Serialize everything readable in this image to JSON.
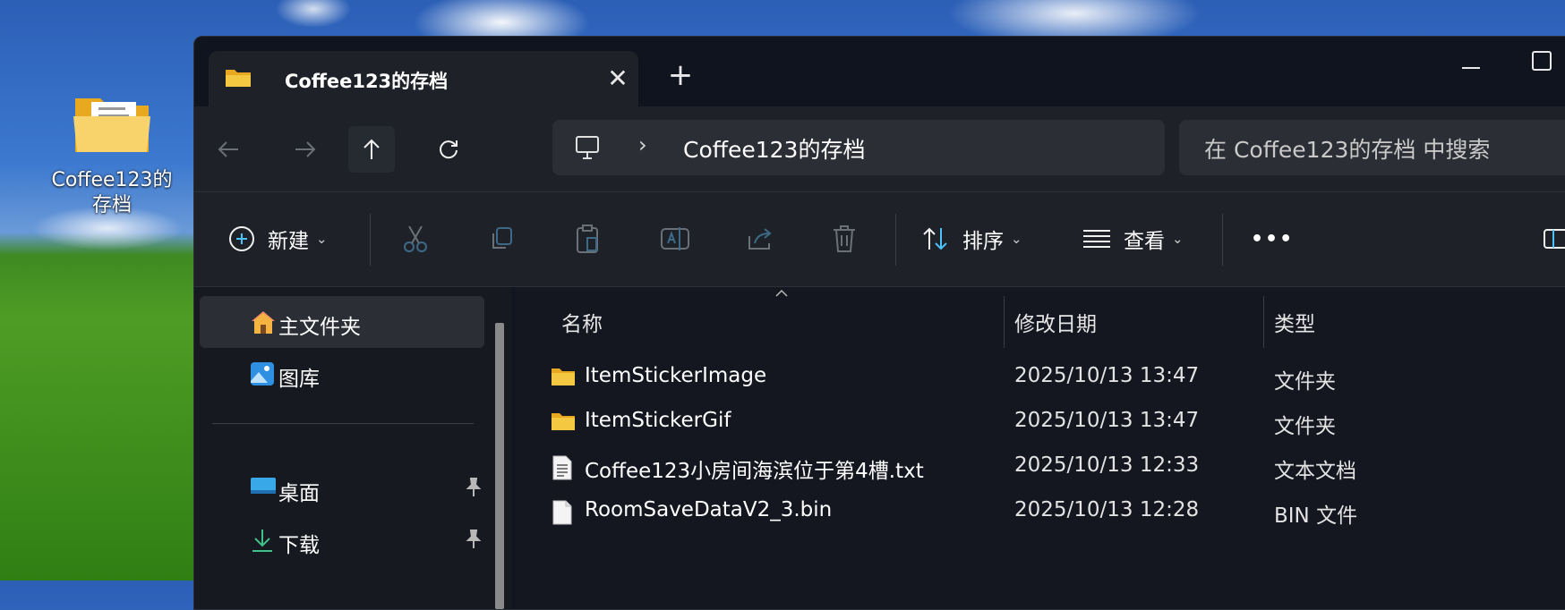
{
  "desktop": {
    "icon_label_line1": "Coffee123的",
    "icon_label_line2": "存档"
  },
  "window": {
    "tab_title": "Coffee123的存档",
    "close_tab_glyph": "✕",
    "new_tab_glyph": "+"
  },
  "address": {
    "chevron": "›",
    "path": "Coffee123的存档"
  },
  "search": {
    "placeholder": "在 Coffee123的存档 中搜索"
  },
  "toolbar": {
    "new_label": "新建",
    "sort_label": "排序",
    "view_label": "查看",
    "dropdown_glyph": "⌄",
    "more_glyph": "•••"
  },
  "sidebar": {
    "items": [
      {
        "label": "主文件夹",
        "icon": "home-icon"
      },
      {
        "label": "图库",
        "icon": "gallery-icon"
      },
      {
        "label": "桌面",
        "icon": "desktop-icon"
      },
      {
        "label": "下载",
        "icon": "download-icon"
      }
    ]
  },
  "columns": {
    "name": "名称",
    "modified": "修改日期",
    "type": "类型"
  },
  "files": [
    {
      "name": "ItemStickerImage",
      "modified": "2025/10/13 13:47",
      "type": "文件夹",
      "icon": "folder-icon"
    },
    {
      "name": "ItemStickerGif",
      "modified": "2025/10/13 13:47",
      "type": "文件夹",
      "icon": "folder-icon"
    },
    {
      "name": "Coffee123小房间海滨位于第4槽.txt",
      "modified": "2025/10/13 12:33",
      "type": "文本文档",
      "icon": "text-file-icon"
    },
    {
      "name": "RoomSaveDataV2_3.bin",
      "modified": "2025/10/13 12:28",
      "type": "BIN 文件",
      "icon": "file-icon"
    }
  ],
  "colors": {
    "folder": "#f5c842",
    "accent": "#4cc2ff",
    "window_bg": "#1e2128"
  }
}
